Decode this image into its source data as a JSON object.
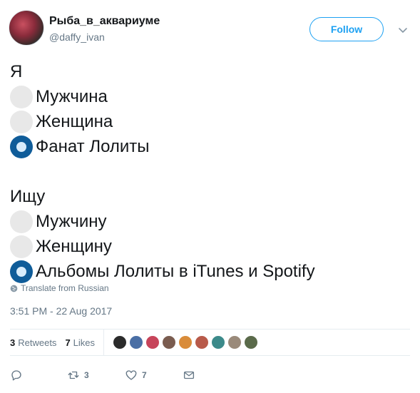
{
  "user": {
    "display_name": "Рыба_в_аквариуме",
    "handle": "@daffy_ivan",
    "follow_label": "Follow"
  },
  "tweet": {
    "lines": [
      {
        "text": "Я",
        "radio": "none"
      },
      {
        "text": "Мужчина",
        "radio": "off"
      },
      {
        "text": "Женщина",
        "radio": "off"
      },
      {
        "text": "Фанат Лолиты",
        "radio": "on"
      },
      {
        "text": "",
        "radio": "none"
      },
      {
        "text": "Ищу",
        "radio": "none"
      },
      {
        "text": "Мужчину",
        "radio": "off"
      },
      {
        "text": "Женщину",
        "radio": "off"
      },
      {
        "text": "Альбомы Лолиты в iTunes и Spotify",
        "radio": "on"
      }
    ],
    "translate_label": "Translate from Russian",
    "timestamp": "3:51 PM - 22 Aug 2017"
  },
  "stats": {
    "retweets_count": "3",
    "retweets_label": "Retweets",
    "likes_count": "7",
    "likes_label": "Likes",
    "liker_avatar_colors": [
      "#2b2b2b",
      "#4a6fa5",
      "#c7445a",
      "#7a5c4f",
      "#d98c3a",
      "#b85a4a",
      "#3c8a8a",
      "#9a8a7a",
      "#5a6a4a"
    ]
  },
  "actions": {
    "reply_count": "",
    "retweet_count": "3",
    "like_count": "7"
  },
  "colors": {
    "accent": "#1da1f2",
    "radio_on": "#0f5c99",
    "radio_off": "#e8e8e8",
    "muted": "#657786"
  }
}
